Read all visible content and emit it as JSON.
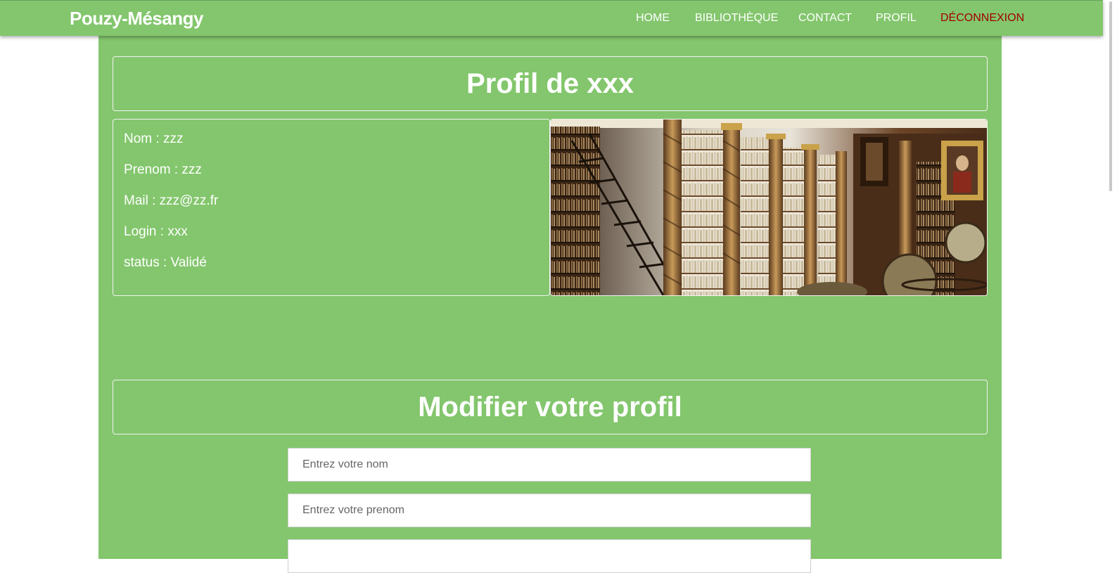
{
  "nav": {
    "brand": "Pouzy-Mésangy",
    "items": [
      {
        "label": "HOME"
      },
      {
        "label": "BIBLIOTHÈQUE"
      },
      {
        "label": "CONTACT"
      },
      {
        "label": "PROFIL"
      },
      {
        "label": "DÉCONNEXION"
      }
    ]
  },
  "profile": {
    "title": "Profil de xxx",
    "lines": [
      "Nom : zzz",
      "Prenom : zzz",
      "Mail : zzz@zz.fr",
      "Login : xxx",
      "status : Validé"
    ]
  },
  "edit": {
    "title": "Modifier votre profil",
    "fields": [
      {
        "placeholder": "Entrez votre nom"
      },
      {
        "placeholder": "Entrez votre prenom"
      },
      {
        "placeholder": ""
      }
    ]
  },
  "colors": {
    "primary": "#83c66d",
    "logout": "#a30000",
    "text": "#ffffff"
  }
}
